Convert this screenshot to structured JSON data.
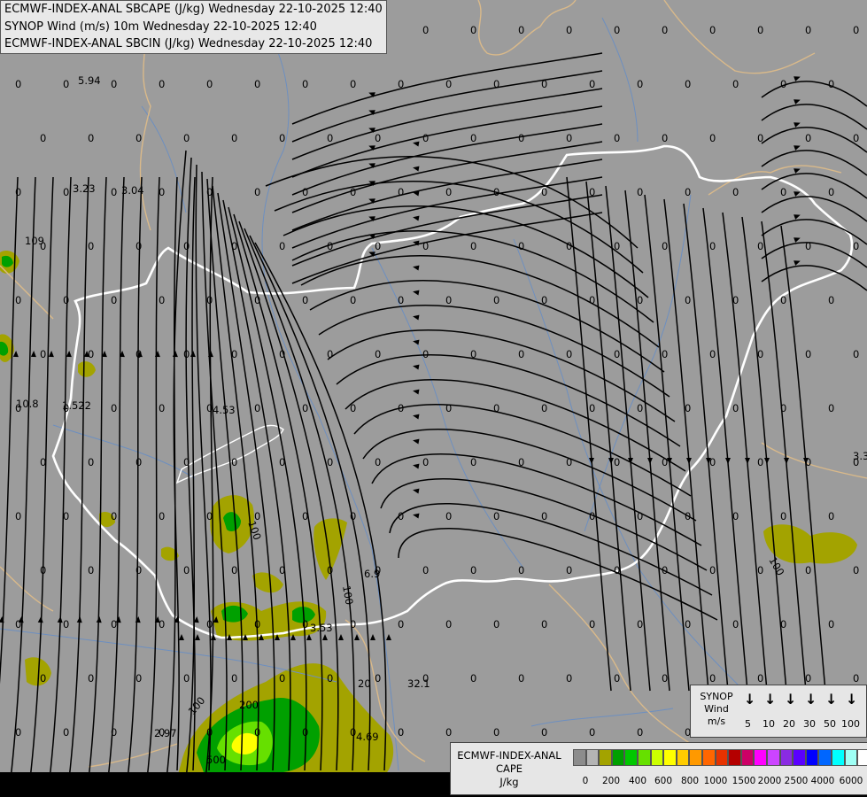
{
  "header": {
    "line1": "ECMWF-INDEX-ANAL SBCAPE (J/kg) Wednesday 22-10-2025 12:40",
    "line2": "SYNOP Wind (m/s) 10m Wednesday 22-10-2025 12:40",
    "line3": "ECMWF-INDEX-ANAL SBCIN (J/kg) Wednesday 22-10-2025 12:40"
  },
  "colors": {
    "background": "#9c9c9c",
    "border_country": "#ffffff",
    "border_region": "#d9b98a",
    "rivers": "#6d8fc0",
    "streamline": "#000000"
  },
  "map_values": [
    {
      "t": "5.94"
    },
    {
      "t": "3.23"
    },
    {
      "t": "3.04"
    },
    {
      "t": "109"
    },
    {
      "t": "10.8"
    },
    {
      "t": "1.522"
    },
    {
      "t": "4.53"
    },
    {
      "t": "100"
    },
    {
      "t": "6.9"
    },
    {
      "t": "100"
    },
    {
      "t": "3.53"
    },
    {
      "t": "20"
    },
    {
      "t": "32.1"
    },
    {
      "t": "2.97"
    },
    {
      "t": "100"
    },
    {
      "t": "200"
    },
    {
      "t": "500"
    },
    {
      "t": "4.69"
    },
    {
      "t": "3.3"
    },
    {
      "t": "100"
    }
  ],
  "synop_legend": {
    "title": "SYNOP Wind m/s",
    "title_lines": [
      "SYNOP",
      "Wind",
      "m/s"
    ],
    "speeds": [
      "5",
      "10",
      "20",
      "30",
      "50",
      "100"
    ]
  },
  "cape_legend": {
    "title_lines": [
      "ECMWF-INDEX-ANAL",
      "CAPE",
      "J/kg"
    ],
    "colors": [
      "#8c8c8c",
      "#b4b4b4",
      "#a3a300",
      "#00a000",
      "#00c800",
      "#66e000",
      "#ccff00",
      "#ffff00",
      "#ffcc00",
      "#ff9900",
      "#ff6600",
      "#e63200",
      "#b40000",
      "#cc0066",
      "#ff00ff",
      "#cc44ff",
      "#8a2be2",
      "#5a00ff",
      "#0000ff",
      "#0066ff",
      "#00ffff",
      "#9ffff5",
      "#ffffff"
    ],
    "labels": [
      "0",
      "200",
      "400",
      "600",
      "800",
      "1000",
      "1500",
      "2000",
      "2500",
      "4000",
      "6000"
    ]
  }
}
